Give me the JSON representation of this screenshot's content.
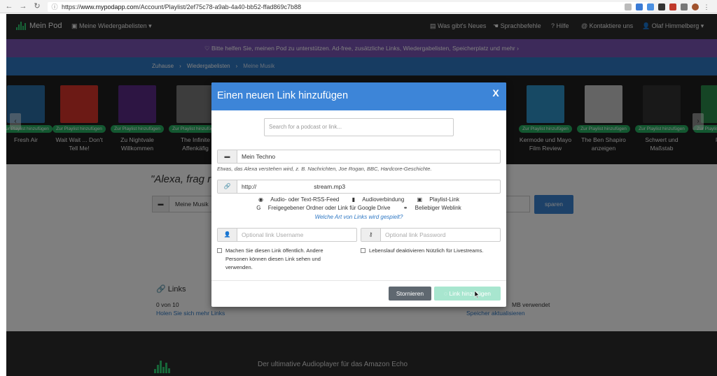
{
  "browser": {
    "url_prefix": "https://",
    "url_host": "www.mypodapp.com",
    "url_path": "/Account/Playlist/2ef75c78-a9ab-4a40-bb52-ffad869c7b88"
  },
  "topnav": {
    "brand": "Mein Pod",
    "playlists": "Meine Wiedergabelisten",
    "whats_new": "Was gibt's Neues",
    "voice_commands": "Sprachbefehle",
    "help": "Hilfe",
    "contact": "Kontaktiere uns",
    "user": "Olaf Himmelberg"
  },
  "banner": {
    "text": "Bitte helfen Sie, meinen Pod zu unterstützen. Ad-free, zusätzliche Links, Wiedergabelisten, Speicherplatz und mehr ›"
  },
  "breadcrumb": {
    "home": "Zuhause",
    "playlists": "Wiedergabelisten",
    "current": "Meine Musik",
    "sep": "›"
  },
  "podcasts": {
    "badge": "Zur Playlist hinzufügen",
    "items": [
      {
        "title": "Fresh Air",
        "color": "#2a6ea6"
      },
      {
        "title": "Wait Wait ... Don't Tell Me!",
        "color": "#d9352b"
      },
      {
        "title": "Zu Nightvale Willkommen",
        "color": "#5a2a86"
      },
      {
        "title": "The Infinite Affenkäfig",
        "color": "#7a7a7a"
      },
      {
        "title": "Kermode und Mayo Film Review",
        "color": "#2f93c9"
      },
      {
        "title": "The Ben Shapiro anzeigen",
        "color": "#c8c8c8"
      },
      {
        "title": "Schwert und Maßstab",
        "color": "#333333"
      },
      {
        "title": "Pla",
        "color": "#2a8a4a"
      }
    ]
  },
  "main": {
    "alexa_prompt": "\"Alexa, frag r",
    "music_value": "Meine Musik",
    "save": "sparen",
    "links_heading": "Links",
    "links_count": "0 von 10",
    "links_more": "Holen Sie sich mehr Links",
    "storage_used": "MB verwendet",
    "storage_update": "Speicher aktualisieren"
  },
  "footer": {
    "tagline": "Der ultimative Audioplayer für das Amazon Echo"
  },
  "modal": {
    "title": "Einen neuen Link hinzufügen",
    "close": "X",
    "search_placeholder": "Search for a podcast or link...",
    "name_value": "Mein Techno",
    "hint": "Etwas, das Alexa verstehen wird, z. B. Nachrichten, Joe Rogan, BBC, Hardcore-Geschichte.",
    "url_value_start": "http://",
    "url_value_end": "stream.mp3",
    "types_row1": [
      "Audio- oder Text-RSS-Feed",
      "Audioverbindung",
      "Playlist-Link"
    ],
    "types_row2": [
      "Freigegebener Ordner oder Link für Google Drive",
      "Beliebiger Weblink"
    ],
    "type_question": "Welche Art von Links wird gespielt?",
    "username_placeholder": "Optional link Username",
    "password_placeholder": "Optional link Password",
    "public_label": "Machen Sie diesen Link öffentlich. Andere Personen können diesen Link sehen und verwenden.",
    "resume_label": "Lebenslauf deaktivieren Nützlich für Livestreams.",
    "cancel": "Stornieren",
    "add": "Link hinzufügen"
  },
  "colors": {
    "accent": "#3d85d8",
    "banner": "#7b55b4",
    "badge": "#27ae60",
    "add_button": "#a8e6cf"
  }
}
